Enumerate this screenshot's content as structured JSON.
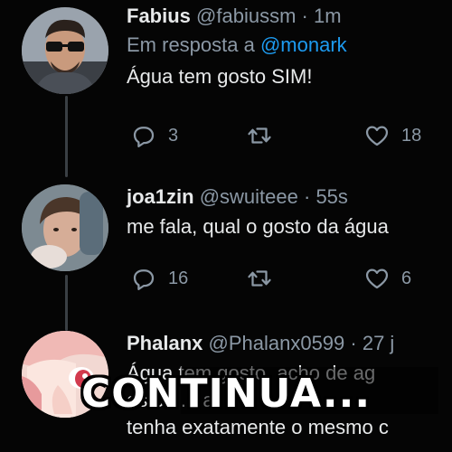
{
  "tweets": [
    {
      "name": "Fabius",
      "handle": "@fabiussm",
      "time": "· 1m",
      "reply_prefix": "Em resposta a",
      "reply_mention": "@monark",
      "text": "Água tem gosto SIM!",
      "replies": "3",
      "likes": "18"
    },
    {
      "name": "joa1zin",
      "handle": "@swuiteee",
      "time": "· 55s",
      "text": "me fala, qual o gosto da água",
      "replies": "16",
      "likes": "6"
    },
    {
      "name": "Phalanx",
      "handle": "@Phalanx0599",
      "time": "· 27 j",
      "text_line1": "Água tem gosto, acho de ag",
      "text_line2": "estou ... a",
      "text_line3": "tenha exatamente o mesmo c"
    }
  ],
  "overlay": {
    "caption": "CONTINUA..."
  },
  "colors": {
    "background": "#050505",
    "name": "#e7e9ea",
    "secondary": "#8b98a5",
    "mention": "#1d9bf0",
    "thread_line": "#3a3f44"
  },
  "icons": [
    "reply-icon",
    "retweet-icon",
    "like-icon"
  ]
}
